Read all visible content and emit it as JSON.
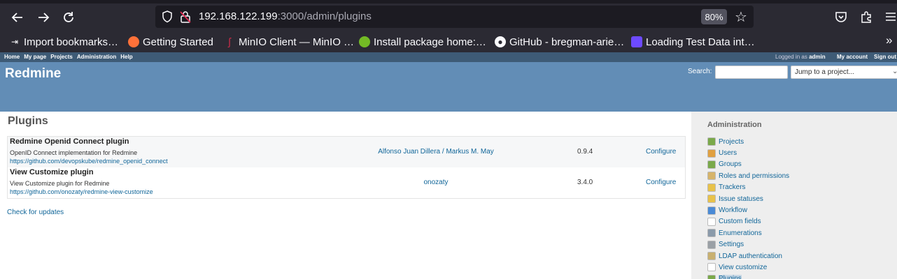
{
  "browser": {
    "url_host": "192.168.122.199",
    "url_rest": ":3000/admin/plugins",
    "zoom": "80%",
    "bookmarks": [
      {
        "label": "Import bookmarks…",
        "icon": "import-icon",
        "color": "#fbfbfe"
      },
      {
        "label": "Getting Started",
        "icon": "firefox-icon",
        "color": "#ff7139"
      },
      {
        "label": "MinIO Client — MinIO …",
        "icon": "minio-icon",
        "color": "#c72c48"
      },
      {
        "label": "Install package home:…",
        "icon": "opensuse-icon",
        "color": "#73ba25"
      },
      {
        "label": "GitHub - bregman-arie…",
        "icon": "github-icon",
        "color": "#fbfbfe"
      },
      {
        "label": "Loading Test Data int…",
        "icon": "proton-icon",
        "color": "#6d4aff"
      }
    ]
  },
  "topmenu": {
    "links": [
      "Home",
      "My page",
      "Projects",
      "Administration",
      "Help"
    ],
    "logged_prefix": "Logged in as",
    "user": "admin",
    "my_account": "My account",
    "sign_out": "Sign out"
  },
  "header": {
    "site_title": "Redmine",
    "search_label": "Search:",
    "jump_placeholder": "Jump to a project..."
  },
  "main": {
    "title": "Plugins",
    "plugins": [
      {
        "name": "Redmine Openid Connect plugin",
        "description": "OpenID Connect implementation for Redmine",
        "url": "https://github.com/devopskube/redmine_openid_connect",
        "author": "Alfonso Juan Dillera / Markus M. May",
        "version": "0.9.4",
        "configure": "Configure"
      },
      {
        "name": "View Customize plugin",
        "description": "View Customize plugin for Redmine",
        "url": "https://github.com/onozaty/redmine-view-customize",
        "author": "onozaty",
        "version": "3.4.0",
        "configure": "Configure"
      }
    ],
    "check_updates": "Check for updates"
  },
  "sidebar": {
    "title": "Administration",
    "items": [
      {
        "label": "Projects",
        "icon": "projects-icon",
        "color": "#7aa94a"
      },
      {
        "label": "Users",
        "icon": "users-icon",
        "color": "#e0a040"
      },
      {
        "label": "Groups",
        "icon": "groups-icon",
        "color": "#7aa94a"
      },
      {
        "label": "Roles and permissions",
        "icon": "roles-icon",
        "color": "#d6b46a"
      },
      {
        "label": "Trackers",
        "icon": "trackers-icon",
        "color": "#e8c24a"
      },
      {
        "label": "Issue statuses",
        "icon": "issue-statuses-icon",
        "color": "#e8c24a"
      },
      {
        "label": "Workflow",
        "icon": "workflow-icon",
        "color": "#4a8ad6"
      },
      {
        "label": "Custom fields",
        "icon": "custom-fields-icon",
        "color": "#ffffff"
      },
      {
        "label": "Enumerations",
        "icon": "enumerations-icon",
        "color": "#8a9aaa"
      },
      {
        "label": "Settings",
        "icon": "settings-icon",
        "color": "#9aa0a6"
      },
      {
        "label": "LDAP authentication",
        "icon": "ldap-icon",
        "color": "#c8b070"
      },
      {
        "label": "View customize",
        "icon": "view-customize-icon",
        "color": "#ffffff"
      },
      {
        "label": "Plugins",
        "icon": "plugins-icon",
        "color": "#7aa94a",
        "selected": true
      }
    ]
  }
}
